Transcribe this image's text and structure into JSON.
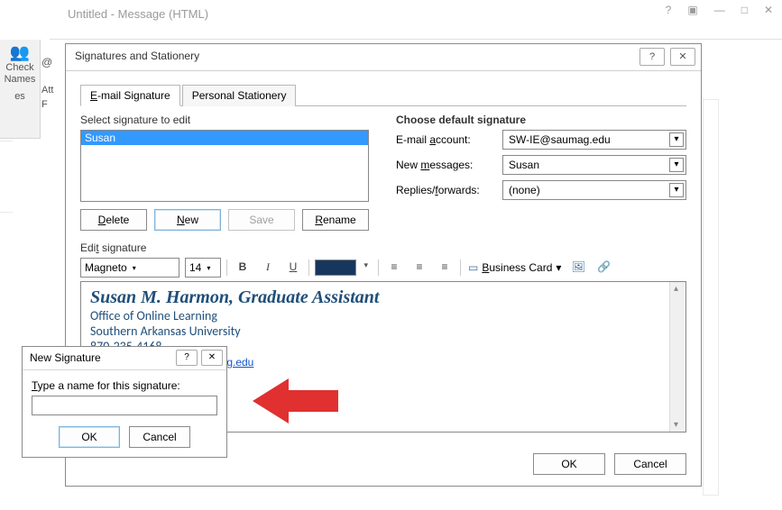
{
  "message_window": {
    "title": "Untitled - Message (HTML)",
    "help": "?",
    "restore": "▣",
    "min": "—",
    "max": "□",
    "close": "✕"
  },
  "ribbon": {
    "check_names": "Check\nNames",
    "att_label": "Att",
    "es_label": "es",
    "F_label": "F"
  },
  "sig_dialog": {
    "title": "Signatures and Stationery",
    "help": "?",
    "close": "✕",
    "tabs": {
      "email": "E-mail Signature",
      "stationery": "Personal Stationery"
    },
    "left": {
      "select_label": "Select signature to edit",
      "list_item": "Susan",
      "buttons": {
        "delete": "Delete",
        "new": "New",
        "save": "Save",
        "rename": "Rename"
      }
    },
    "right": {
      "header": "Choose default signature",
      "email_account_label": "E-mail account:",
      "email_account_value": "SW-IE@saumag.edu",
      "new_messages_label": "New messages:",
      "new_messages_value": "Susan",
      "replies_label": "Replies/forwards:",
      "replies_value": "(none)"
    },
    "edit_label": "Edit signature",
    "toolbar": {
      "font": "Magneto",
      "size": "14",
      "bold": "B",
      "italic": "I",
      "underline": "U",
      "biz_card": "Business Card"
    },
    "editor": {
      "line1": "Susan M. Harmon, Graduate Assistant",
      "line2": "Office of Online Learning",
      "line3": "Southern Arkansas University",
      "line4": "870-235-4168",
      "line5_partial": "ders.saumag.edu"
    },
    "footer": {
      "ok": "OK",
      "cancel": "Cancel"
    }
  },
  "new_sig_dialog": {
    "title": "New Signature",
    "help": "?",
    "close": "✕",
    "prompt": "Type a name for this signature:",
    "value": "",
    "ok": "OK",
    "cancel": "Cancel"
  }
}
